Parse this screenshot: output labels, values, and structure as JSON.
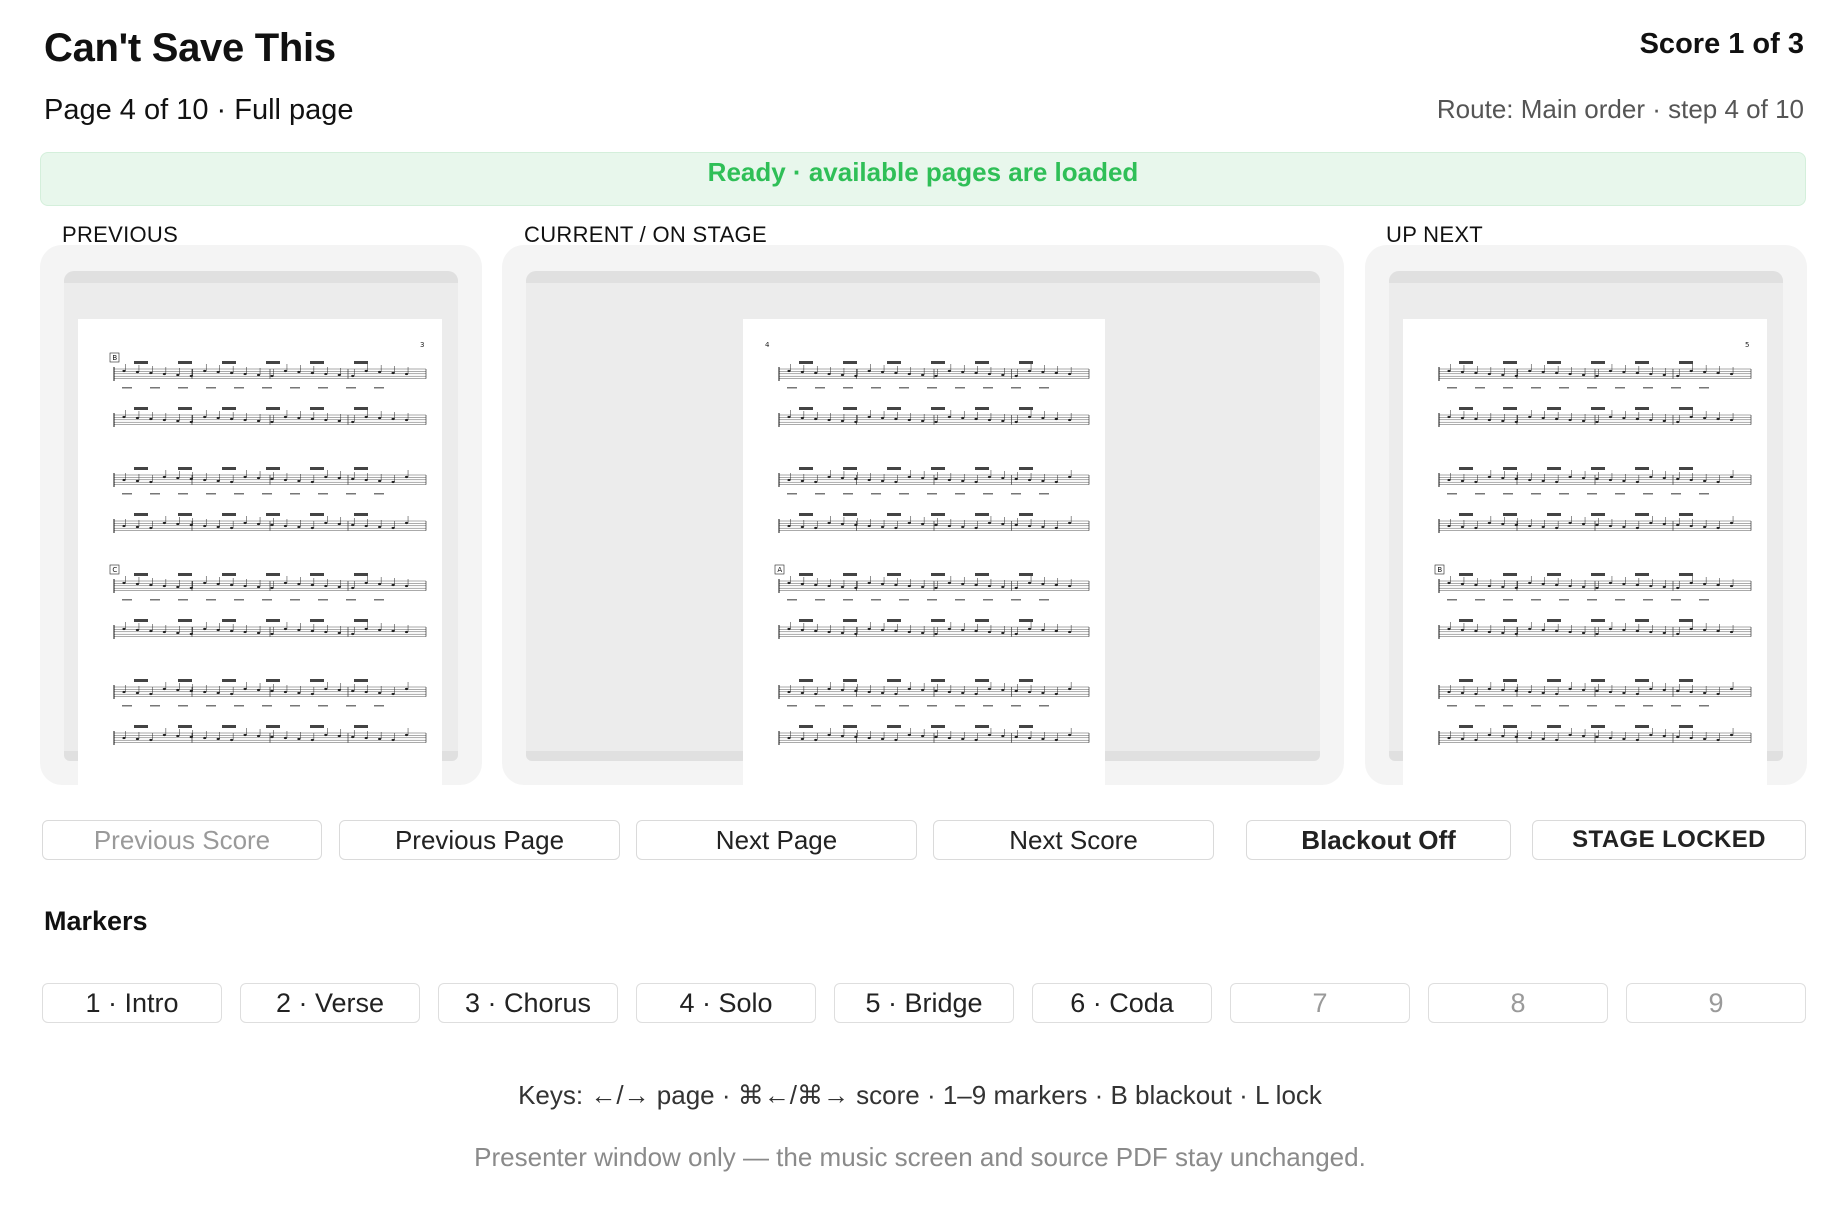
{
  "header": {
    "title": "Can't Save This",
    "score_position": "Score 1 of 3",
    "page_info": "Page 4 of 10 · Full page",
    "route": "Route: Main order · step 4 of 10"
  },
  "status": {
    "text": "Ready · available pages are loaded",
    "color": "#2fbf57"
  },
  "panels": {
    "previous": {
      "label": "PREVIOUS",
      "page_number": "3",
      "rehearsal_marks": [
        "B",
        "C"
      ]
    },
    "current": {
      "label": "CURRENT / ON STAGE",
      "page_number": "4",
      "rehearsal_marks": [
        "A"
      ]
    },
    "next": {
      "label": "UP NEXT",
      "page_number": "5",
      "rehearsal_marks": [
        "B"
      ]
    }
  },
  "controls": {
    "previous_score": "Previous Score",
    "previous_page": "Previous Page",
    "next_page": "Next Page",
    "next_score": "Next Score",
    "blackout": "Blackout Off",
    "lock": "STAGE LOCKED"
  },
  "markers": {
    "heading": "Markers",
    "items": [
      "1 · Intro",
      "2 · Verse",
      "3 · Chorus",
      "4 · Solo",
      "5 · Bridge",
      "6 · Coda",
      "7",
      "8",
      "9"
    ]
  },
  "footer": {
    "keys": "Keys: ←/→ page · ⌘←/⌘→ score · 1–9 markers · B blackout · L lock",
    "note": "Presenter window only — the music screen and source PDF stay unchanged."
  }
}
